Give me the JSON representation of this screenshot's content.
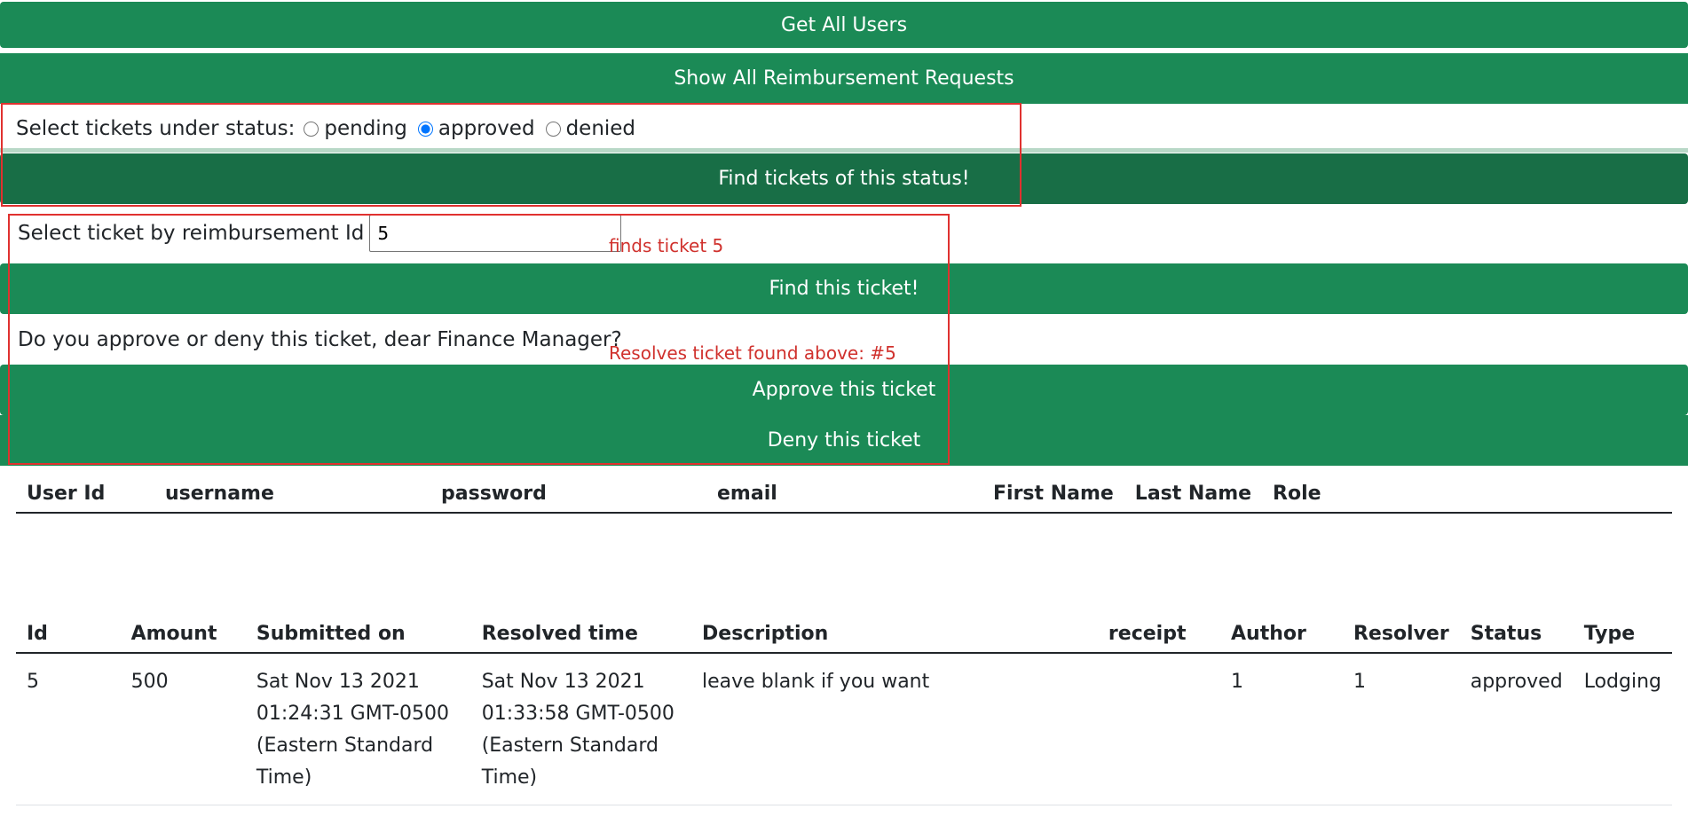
{
  "buttons": {
    "get_all_users": "Get All Users",
    "show_all_requests": "Show All Reimbursement Requests",
    "find_by_status": "Find tickets of this status!",
    "find_ticket": "Find this ticket!",
    "approve": "Approve this ticket",
    "deny": "Deny this ticket"
  },
  "status_filter": {
    "label": "Select tickets under status:",
    "options": [
      {
        "label": "pending",
        "checked": false
      },
      {
        "label": "approved",
        "checked": true
      },
      {
        "label": "denied",
        "checked": false
      }
    ]
  },
  "ticket_lookup": {
    "label": "Select ticket by reimbursement Id",
    "value": "5"
  },
  "resolve": {
    "question": "Do you approve or deny this ticket, dear Finance Manager?"
  },
  "annotations": {
    "finds": "finds ticket 5",
    "resolves": "Resolves ticket found above: #5",
    "color": "#e0312f"
  },
  "users_table": {
    "headers": [
      "User Id",
      "username",
      "password",
      "email",
      "First Name",
      "Last Name",
      "Role"
    ]
  },
  "tickets_table": {
    "headers": [
      "Id",
      "Amount",
      "Submitted on",
      "Resolved time",
      "Description",
      "receipt",
      "Author",
      "Resolver",
      "Status",
      "Type"
    ],
    "rows": [
      {
        "id": "5",
        "amount": "500",
        "submitted": "Sat Nov 13 2021 01:24:31 GMT-0500 (Eastern Standard Time)",
        "resolved": "Sat Nov 13 2021 01:33:58 GMT-0500 (Eastern Standard Time)",
        "description": "leave blank if you want",
        "receipt": "",
        "author": "1",
        "resolver": "1",
        "status": "approved",
        "type": "Lodging"
      }
    ]
  },
  "colors": {
    "button": "#1b8a56",
    "button_active": "#186e46"
  }
}
